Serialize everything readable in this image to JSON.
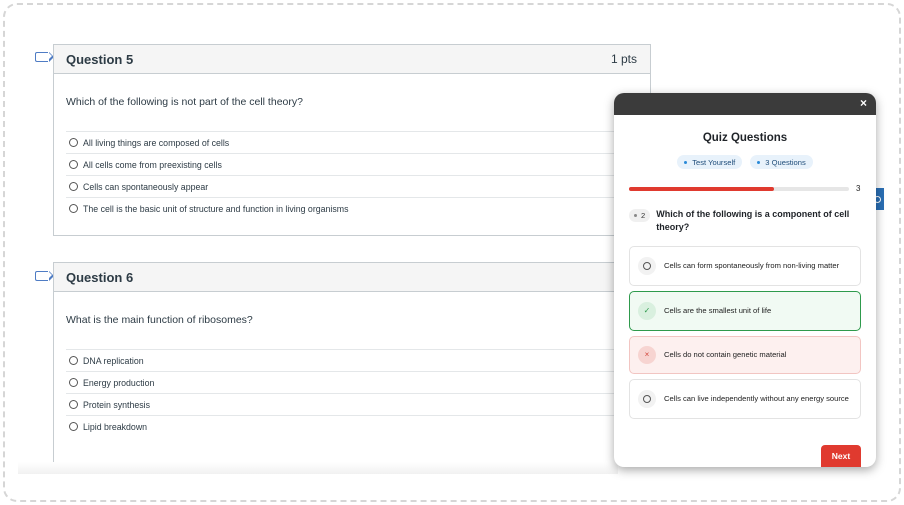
{
  "lms": {
    "questions": [
      {
        "title": "Question 5",
        "points": "1 pts",
        "text": "Which of the following is not part of the cell theory?",
        "answers": [
          "All living things are composed of cells",
          "All cells come from preexisting cells",
          "Cells can spontaneously appear",
          "The cell is the basic unit of structure and function in living organisms"
        ]
      },
      {
        "title": "Question 6",
        "text": "What is the main function of ribosomes?",
        "answers": [
          "DNA replication",
          "Energy production",
          "Protein synthesis",
          "Lipid breakdown"
        ]
      }
    ]
  },
  "quiz": {
    "close_label": "×",
    "title": "Quiz Questions",
    "pills": [
      "Test Yourself",
      "3 Questions"
    ],
    "progress": {
      "fraction": 0.66,
      "count": "3"
    },
    "question_number": "2",
    "question": "Which of the following is a component of cell theory?",
    "options": [
      {
        "text": "Cells can form spontaneously from non-living matter",
        "state": "empty"
      },
      {
        "text": "Cells are the smallest unit of life",
        "state": "correct"
      },
      {
        "text": "Cells do not contain genetic material",
        "state": "incorrect"
      },
      {
        "text": "Cells can live independently without any energy source",
        "state": "empty"
      }
    ],
    "correct_symbol": "✓",
    "incorrect_symbol": "×",
    "next_label": "Next",
    "colors": {
      "accent": "#e03a2f",
      "correct": "#2e9a4c",
      "incorrect": "#d2463b",
      "header": "#3b3b3b"
    }
  }
}
